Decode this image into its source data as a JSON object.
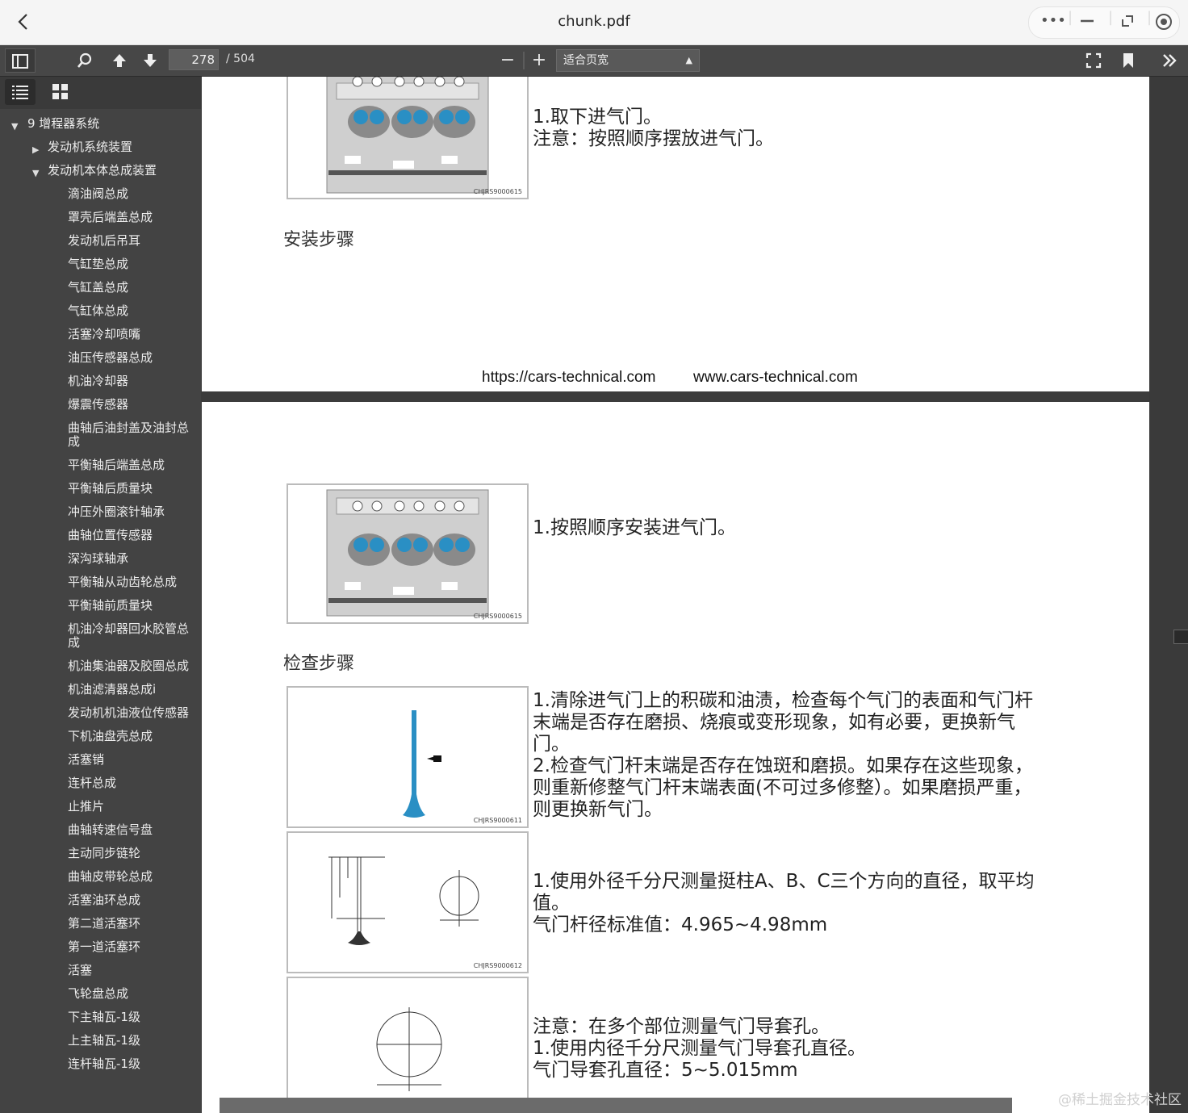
{
  "window": {
    "title": "chunk.pdf"
  },
  "toolbar": {
    "page_current": "278",
    "page_total": "/ 504",
    "zoom": "适合页宽"
  },
  "outline": {
    "items": [
      {
        "label": "9 增程器系统",
        "level": 0,
        "state": "expanded"
      },
      {
        "label": "发动机系统装置",
        "level": 1,
        "state": "collapsed"
      },
      {
        "label": "发动机本体总成装置",
        "level": 1,
        "state": "expanded"
      },
      {
        "label": "滴油阀总成",
        "level": 2
      },
      {
        "label": "罩壳后端盖总成",
        "level": 2
      },
      {
        "label": "发动机后吊耳",
        "level": 2
      },
      {
        "label": "气缸垫总成",
        "level": 2
      },
      {
        "label": "气缸盖总成",
        "level": 2
      },
      {
        "label": "气缸体总成",
        "level": 2
      },
      {
        "label": "活塞冷却喷嘴",
        "level": 2
      },
      {
        "label": "油压传感器总成",
        "level": 2
      },
      {
        "label": "机油冷却器",
        "level": 2
      },
      {
        "label": "爆震传感器",
        "level": 2
      },
      {
        "label": "曲轴后油封盖及油封总成",
        "level": 2
      },
      {
        "label": "平衡轴后端盖总成",
        "level": 2
      },
      {
        "label": "平衡轴后质量块",
        "level": 2
      },
      {
        "label": "冲压外圈滚针轴承",
        "level": 2
      },
      {
        "label": "曲轴位置传感器",
        "level": 2
      },
      {
        "label": "深沟球轴承",
        "level": 2
      },
      {
        "label": "平衡轴从动齿轮总成",
        "level": 2
      },
      {
        "label": "平衡轴前质量块",
        "level": 2
      },
      {
        "label": "机油冷却器回水胶管总成",
        "level": 2
      },
      {
        "label": "机油集油器及胶圈总成",
        "level": 2
      },
      {
        "label": "机油滤清器总成i",
        "level": 2
      },
      {
        "label": "发动机机油液位传感器",
        "level": 2
      },
      {
        "label": "下机油盘壳总成",
        "level": 2
      },
      {
        "label": "活塞销",
        "level": 2
      },
      {
        "label": "连杆总成",
        "level": 2
      },
      {
        "label": "止推片",
        "level": 2
      },
      {
        "label": "曲轴转速信号盘",
        "level": 2
      },
      {
        "label": "主动同步链轮",
        "level": 2
      },
      {
        "label": "曲轴皮带轮总成",
        "level": 2
      },
      {
        "label": "活塞油环总成",
        "level": 2
      },
      {
        "label": "第二道活塞环",
        "level": 2
      },
      {
        "label": "第一道活塞环",
        "level": 2
      },
      {
        "label": "活塞",
        "level": 2
      },
      {
        "label": "飞轮盘总成",
        "level": 2
      },
      {
        "label": "下主轴瓦-1级",
        "level": 2
      },
      {
        "label": "上主轴瓦-1级",
        "level": 2
      },
      {
        "label": "连杆轴瓦-1级",
        "level": 2
      }
    ]
  },
  "page1": {
    "step_text": "1.取下进气门。\n注意：按照顺序摆放进气门。",
    "fig_code": "CHJRS9000615",
    "heading_install": "安装步骤",
    "url_left": "https://cars-technical.com",
    "url_right": "www.cars-technical.com"
  },
  "page2": {
    "install_text": "1.按照顺序安装进气门。",
    "fig1_code": "CHJRS9000615",
    "heading_check": "检查步骤",
    "check1_text": "1.清除进气门上的积碳和油渍，检查每个气门的表面和气门杆\n末端是否存在磨损、烧痕或变形现象，如有必要，更换新气\n门。\n2.检查气门杆末端是否存在蚀斑和磨损。如果存在这些现象，\n则重新修整气门杆末端表面(不可过多修整）。如果磨损严重，\n则更换新气门。",
    "fig2_code": "CHJRS9000611",
    "check2_text": "1.使用外径千分尺测量挺柱A、B、C三个方向的直径，取平均\n值。\n气门杆径标准值：4.965~4.98mm",
    "fig3_code": "CHJRS9000612",
    "check3_text": "注意：在多个部位测量气门导套孔。\n1.使用内径千分尺测量气门导套孔直径。\n气门导套孔直径：5~5.015mm"
  },
  "credit": "@稀土掘金技术社区",
  "colors": {
    "valve_blue": "#2a8fc4",
    "toolbar": "#474747",
    "sidebar": "#434343"
  }
}
